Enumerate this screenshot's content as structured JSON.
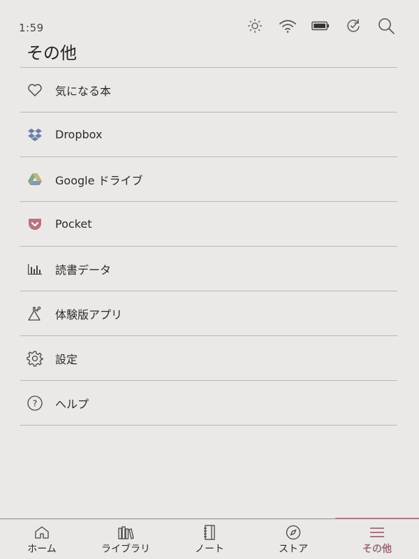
{
  "status": {
    "time": "1:59",
    "icons": [
      "brightness-icon",
      "wifi-icon",
      "battery-icon",
      "sync-icon",
      "search-icon"
    ]
  },
  "page": {
    "title": "その他"
  },
  "menu": {
    "items": [
      {
        "label": "気になる本",
        "icon": "heart-icon"
      },
      {
        "label": "Dropbox",
        "icon": "dropbox-icon"
      },
      {
        "label": "Google ドライブ",
        "icon": "google-drive-icon"
      },
      {
        "label": "Pocket",
        "icon": "pocket-icon"
      },
      {
        "label": "読書データ",
        "icon": "bar-chart-icon"
      },
      {
        "label": "体験版アプリ",
        "icon": "flask-icon"
      },
      {
        "label": "設定",
        "icon": "gear-icon"
      },
      {
        "label": "ヘルプ",
        "icon": "help-icon"
      }
    ]
  },
  "tabs": {
    "items": [
      {
        "label": "ホーム",
        "icon": "home-icon"
      },
      {
        "label": "ライブラリ",
        "icon": "library-icon"
      },
      {
        "label": "ノート",
        "icon": "notebook-icon"
      },
      {
        "label": "ストア",
        "icon": "compass-icon"
      },
      {
        "label": "その他",
        "icon": "menu-icon",
        "active": true
      }
    ]
  },
  "colors": {
    "background": "#ebe9e7",
    "active_tab": "#9a6d78",
    "pocket": "#b8737d",
    "dropbox": "#6b7fa8"
  }
}
